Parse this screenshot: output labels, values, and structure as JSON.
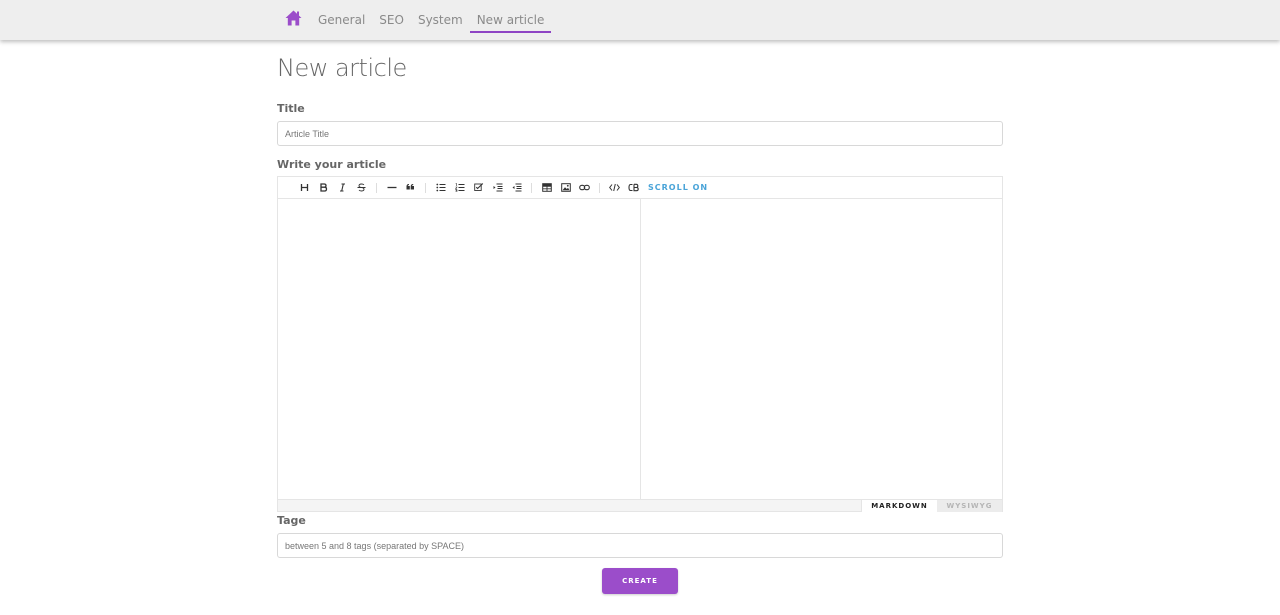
{
  "nav": {
    "home_icon": "home-icon",
    "items": [
      {
        "label": "General"
      },
      {
        "label": "SEO"
      },
      {
        "label": "System"
      },
      {
        "label": "New article",
        "active": true
      }
    ]
  },
  "page": {
    "title": "New article"
  },
  "form": {
    "title_label": "Title",
    "title_placeholder": "Article Title",
    "title_value": "",
    "article_label": "Write your article",
    "tags_label": "Tage",
    "tags_placeholder": "between 5 and 8 tags (separated by SPACE)",
    "tags_value": "",
    "create_label": "CREATE"
  },
  "editor": {
    "toolbar": [
      {
        "icon": "heading-icon"
      },
      {
        "icon": "bold-icon"
      },
      {
        "icon": "italic-icon"
      },
      {
        "icon": "strikethrough-icon"
      },
      {
        "icon": "horizontal-rule-icon"
      },
      {
        "icon": "quote-icon"
      },
      {
        "icon": "bullet-list-icon"
      },
      {
        "icon": "ordered-list-icon"
      },
      {
        "icon": "task-list-icon"
      },
      {
        "icon": "indent-icon"
      },
      {
        "icon": "outdent-icon"
      },
      {
        "icon": "table-icon"
      },
      {
        "icon": "image-icon"
      },
      {
        "icon": "link-icon"
      },
      {
        "icon": "code-icon"
      },
      {
        "icon": "code-block-icon"
      }
    ],
    "scroll_toggle": "SCROLL ON",
    "markdown_content": "",
    "mode_tabs": {
      "markdown": "MARKDOWN",
      "wysiwyg": "WYSIWYG",
      "active": "markdown"
    }
  },
  "colors": {
    "accent": "#9b4dca",
    "nav_underline": "#8e44c4",
    "scroll_toggle": "#4aa4d8",
    "topbar_bg": "#eeeeee"
  }
}
